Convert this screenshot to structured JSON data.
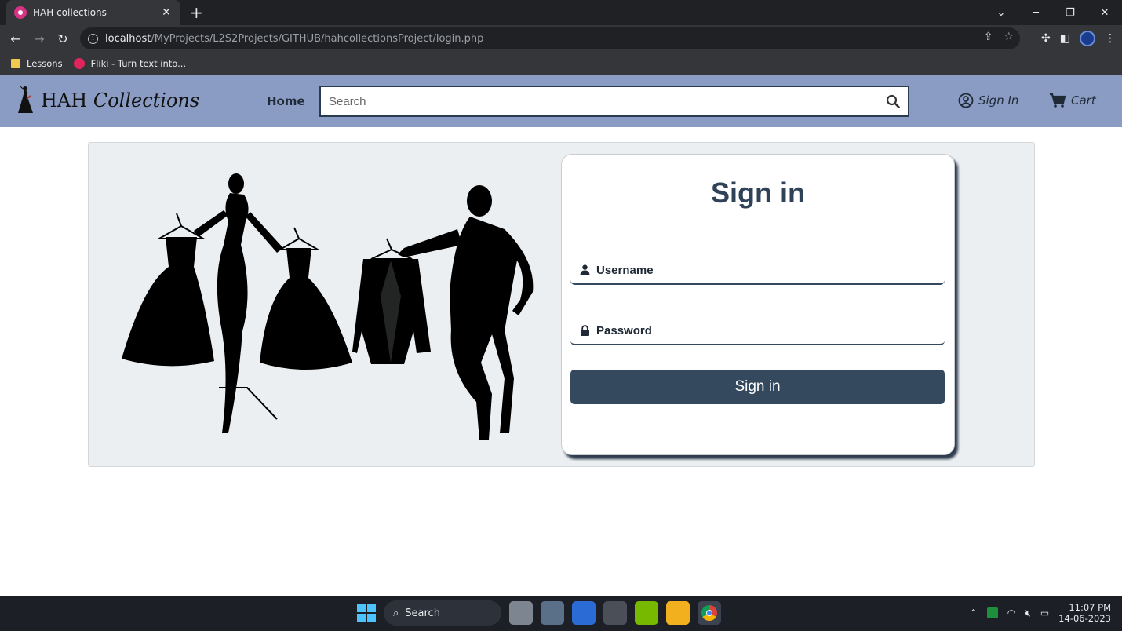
{
  "browser": {
    "tab_title": "HAH collections",
    "url_host": "localhost",
    "url_path": "/MyProjects/L2S2Projects/GITHUB/hahcollectionsProject/login.php",
    "bookmarks": [
      {
        "label": "Lessons",
        "icon": "folder-icon"
      },
      {
        "label": "Fliki - Turn text into...",
        "icon": "fliki-icon"
      }
    ]
  },
  "site": {
    "brand_plain": "HAH ",
    "brand_script": "Collections",
    "nav_home": "Home",
    "search_placeholder": "Search",
    "sign_in_link": "Sign In",
    "cart_link": "Cart",
    "colors": {
      "nav_bg": "#8a9cc4",
      "accent": "#34495e"
    }
  },
  "login": {
    "title": "Sign in",
    "username_placeholder": "Username",
    "password_placeholder": "Password",
    "submit_label": "Sign in"
  },
  "taskbar": {
    "search_label": "Search",
    "time": "11:07 PM",
    "date": "14-06-2023"
  }
}
